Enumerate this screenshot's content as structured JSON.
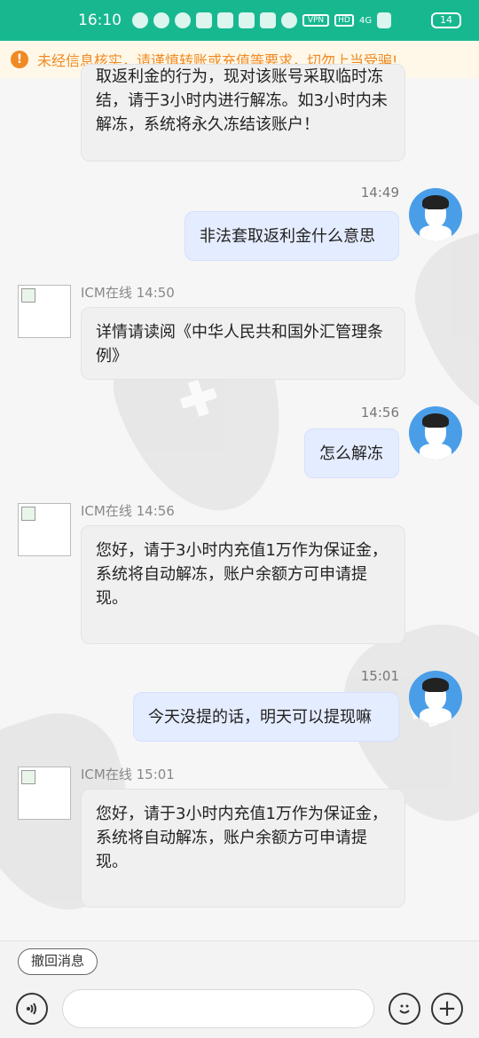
{
  "status_bar": {
    "time": "16:10",
    "badge_vpn": "VPN",
    "badge_hd": "HD",
    "network": "4G",
    "battery": "14"
  },
  "warning": {
    "icon": "!",
    "text": "未经信息核实，请谨慎转账或充值等要求，切勿上当受骗!"
  },
  "messages": [
    {
      "side": "left",
      "sender": "",
      "text": "取返利金的行为，现对该账号采取临时冻结，请于3小时内进行解冻。如3小时内未解冻，系统将永久冻结该账户！"
    },
    {
      "side": "right",
      "time": "14:49",
      "text": "非法套取返利金什么意思"
    },
    {
      "side": "left",
      "sender": "ICM在线 14:50",
      "text": "详情请读阅《中华人民共和国外汇管理条例》"
    },
    {
      "side": "right",
      "time": "14:56",
      "text": "怎么解冻"
    },
    {
      "side": "left",
      "sender": "ICM在线 14:56",
      "text": "您好，请于3小时内充值1万作为保证金，系统将自动解冻，账户余额方可申请提现。"
    },
    {
      "side": "right",
      "time": "15:01",
      "text": "今天没提的话，明天可以提现嘛"
    },
    {
      "side": "left",
      "sender": "ICM在线 15:01",
      "text": "您好，请于3小时内充值1万作为保证金，系统将自动解冻，账户余额方可申请提现。"
    }
  ],
  "bottom": {
    "recall_label": "撤回消息",
    "voice_icon": "voice-icon",
    "emoji_icon": "emoji-icon",
    "plus_label": "+",
    "input_value": ""
  },
  "colors": {
    "status_bar": "#17b890",
    "warning_text": "#f08a24",
    "right_bubble": "#e4ecff",
    "left_bubble": "#f0f0f0"
  }
}
